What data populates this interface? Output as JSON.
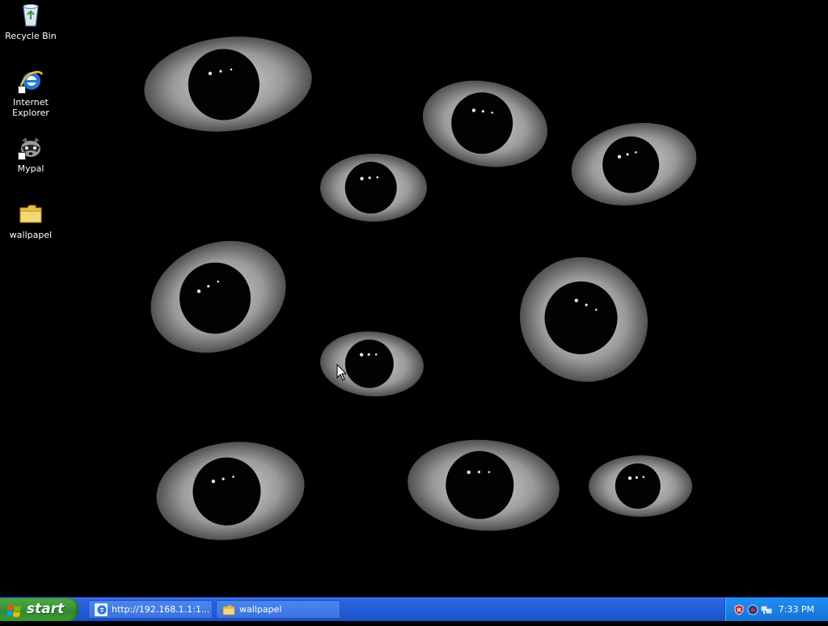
{
  "desktop": {
    "icons": [
      {
        "label": "Recycle Bin",
        "icon": "recycle-bin-icon"
      },
      {
        "label": "Internet Explorer",
        "icon": "internet-explorer-icon"
      },
      {
        "label": "Mypal",
        "icon": "mypal-raccoon-icon"
      },
      {
        "label": "wallpapel",
        "icon": "folder-icon"
      }
    ],
    "wallpaper": "eyes-on-black-wallpaper"
  },
  "taskbar": {
    "start_label": "start",
    "tasks": [
      {
        "label": "http://192.168.1.1:1...",
        "icon": "internet-explorer-icon"
      },
      {
        "label": "wallpapel",
        "icon": "folder-icon"
      }
    ],
    "tray_icons": [
      "security-shield-icon",
      "antivirus-icon",
      "network-icon"
    ],
    "clock": "7:33 PM"
  },
  "colors": {
    "taskbar_blue": "#245edb",
    "start_green": "#3c9a3a",
    "tray_blue": "#1a80e6",
    "desktop_bg": "#000000"
  }
}
